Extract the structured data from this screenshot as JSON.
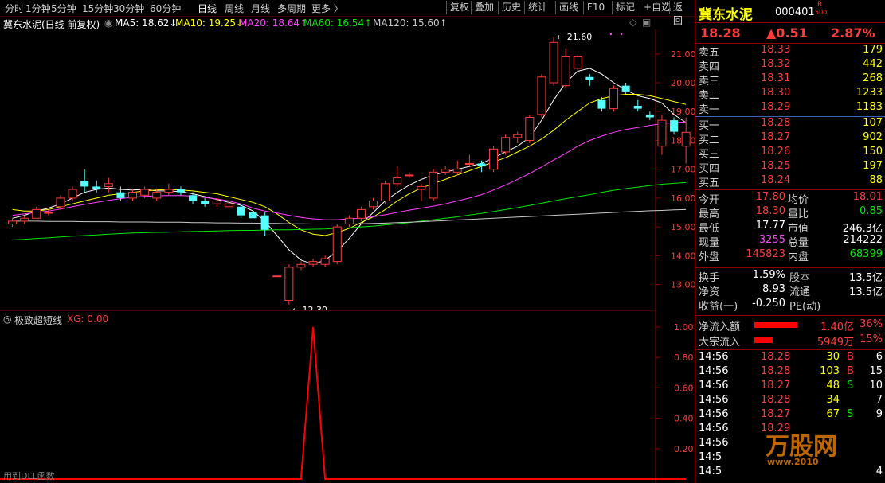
{
  "toolbar": {
    "periods": [
      "分时",
      "1分钟",
      "5分钟",
      "15分钟",
      "30分钟",
      "60分钟",
      "日线",
      "周线",
      "月线",
      "多周期",
      "更多 〉"
    ],
    "active": "日线",
    "buttons": [
      "复权",
      "叠加",
      "历史",
      "统计",
      "画线",
      "F10",
      "标记",
      "+自选",
      "返回"
    ]
  },
  "chart_header": {
    "title": "冀东水泥(日线 前复权)",
    "ma": [
      {
        "label": "MA5: 18.62↓",
        "color": "#ffffff"
      },
      {
        "label": "MA10: 19.25↓",
        "color": "#ffff00"
      },
      {
        "label": "MA20: 18.64↑",
        "color": "#ff40ff"
      },
      {
        "label": "MA60: 16.54↑",
        "color": "#00e600"
      },
      {
        "label": "MA120: 15.60↑",
        "color": "#c8c8c8"
      }
    ]
  },
  "chart_data": {
    "type": "candlestick",
    "y_ticks": [
      21.0,
      20.0,
      19.0,
      18.0,
      17.0,
      16.0,
      15.0,
      14.0,
      13.0
    ],
    "ylim": [
      12.05,
      21.85
    ],
    "high_label": "21.60",
    "low_label": "12.30",
    "low_marker": "跌",
    "candles": [
      [
        15.1,
        15.3,
        15.0,
        15.2
      ],
      [
        15.2,
        15.4,
        15.1,
        15.3
      ],
      [
        15.3,
        15.7,
        15.3,
        15.6
      ],
      [
        15.5,
        15.6,
        15.4,
        15.5
      ],
      [
        15.7,
        16.1,
        15.6,
        16.0
      ],
      [
        16.0,
        16.4,
        15.9,
        16.3
      ],
      [
        16.6,
        17.0,
        16.2,
        16.4
      ],
      [
        16.4,
        16.6,
        16.2,
        16.3
      ],
      [
        16.4,
        16.7,
        16.2,
        16.5
      ],
      [
        16.2,
        16.4,
        15.9,
        16.0
      ],
      [
        16.0,
        16.3,
        15.9,
        16.2
      ],
      [
        16.1,
        16.4,
        16.0,
        16.3
      ],
      [
        16.0,
        16.3,
        15.9,
        16.2
      ],
      [
        16.2,
        16.5,
        16.1,
        16.3
      ],
      [
        16.3,
        16.4,
        16.1,
        16.2
      ],
      [
        16.1,
        16.2,
        15.8,
        15.9
      ],
      [
        15.9,
        16.0,
        15.7,
        15.8
      ],
      [
        15.8,
        16.0,
        15.7,
        15.9
      ],
      [
        15.7,
        15.9,
        15.6,
        15.8
      ],
      [
        15.7,
        15.8,
        15.3,
        15.4
      ],
      [
        15.5,
        15.6,
        15.2,
        15.3
      ],
      [
        15.4,
        15.5,
        14.7,
        14.9
      ],
      [
        13.3,
        13.3,
        13.3,
        13.3
      ],
      [
        12.45,
        13.7,
        12.3,
        13.6
      ],
      [
        13.6,
        13.8,
        13.5,
        13.7
      ],
      [
        13.7,
        13.9,
        13.6,
        13.8
      ],
      [
        13.7,
        14.0,
        13.6,
        13.9
      ],
      [
        13.8,
        15.1,
        13.7,
        15.0
      ],
      [
        15.1,
        15.4,
        15.0,
        15.3
      ],
      [
        15.3,
        15.7,
        15.2,
        15.6
      ],
      [
        15.7,
        16.0,
        15.6,
        15.9
      ],
      [
        15.9,
        16.6,
        15.8,
        16.5
      ],
      [
        16.5,
        17.1,
        16.4,
        16.7
      ],
      [
        16.8,
        16.9,
        16.7,
        16.8
      ],
      [
        16.3,
        16.5,
        15.9,
        16.4
      ],
      [
        16.0,
        17.0,
        15.9,
        16.9
      ],
      [
        16.9,
        17.1,
        16.8,
        17.0
      ],
      [
        16.9,
        17.3,
        16.8,
        17.0
      ],
      [
        17.2,
        17.5,
        17.1,
        17.2
      ],
      [
        17.2,
        17.3,
        16.9,
        17.1
      ],
      [
        17.0,
        17.8,
        16.9,
        17.7
      ],
      [
        17.6,
        18.2,
        17.5,
        18.1
      ],
      [
        18.1,
        18.3,
        17.9,
        18.2
      ],
      [
        18.0,
        18.9,
        17.9,
        18.8
      ],
      [
        18.9,
        20.3,
        18.8,
        20.2
      ],
      [
        20.0,
        21.6,
        19.9,
        21.4
      ],
      [
        19.9,
        21.2,
        19.8,
        20.9
      ],
      [
        20.5,
        21.0,
        20.4,
        20.9
      ],
      [
        20.2,
        20.3,
        19.9,
        20.1
      ],
      [
        19.4,
        19.5,
        19.0,
        19.1
      ],
      [
        19.1,
        19.9,
        19.0,
        19.8
      ],
      [
        19.9,
        20.0,
        19.6,
        19.7
      ],
      [
        19.2,
        19.4,
        19.0,
        19.1
      ],
      [
        18.9,
        19.0,
        18.7,
        18.8
      ],
      [
        17.8,
        18.9,
        17.5,
        18.7
      ],
      [
        18.7,
        18.8,
        18.2,
        18.3
      ],
      [
        17.8,
        18.8,
        17.2,
        18.28
      ]
    ],
    "ma_series": [
      {
        "name": "MA5",
        "color": "#ffffff",
        "values": [
          15.3,
          15.4,
          15.55,
          15.65,
          15.8,
          16.0,
          16.2,
          16.3,
          16.35,
          16.3,
          16.28,
          16.3,
          16.25,
          16.25,
          16.22,
          16.15,
          16.05,
          15.95,
          15.85,
          15.75,
          15.55,
          15.2,
          14.7,
          14.2,
          13.85,
          13.7,
          13.85,
          14.15,
          14.6,
          15.1,
          15.5,
          15.9,
          16.2,
          16.45,
          16.65,
          16.8,
          16.9,
          17.0,
          17.1,
          17.2,
          17.4,
          17.6,
          17.8,
          18.1,
          18.7,
          19.4,
          20.0,
          20.4,
          20.5,
          20.3,
          20.0,
          19.75,
          19.55,
          19.45,
          19.3,
          18.9,
          18.62
        ]
      },
      {
        "name": "MA10",
        "color": "#ffff00",
        "values": [
          15.6,
          15.55,
          15.55,
          15.6,
          15.7,
          15.8,
          15.9,
          16.0,
          16.1,
          16.15,
          16.2,
          16.25,
          16.28,
          16.3,
          16.28,
          16.25,
          16.2,
          16.15,
          16.05,
          15.95,
          15.85,
          15.7,
          15.45,
          15.15,
          14.9,
          14.75,
          14.7,
          14.8,
          14.95,
          15.15,
          15.35,
          15.6,
          15.9,
          16.15,
          16.35,
          16.5,
          16.65,
          16.8,
          16.95,
          17.1,
          17.25,
          17.4,
          17.6,
          17.8,
          18.05,
          18.35,
          18.7,
          19.0,
          19.3,
          19.45,
          19.55,
          19.6,
          19.6,
          19.55,
          19.45,
          19.35,
          19.25
        ]
      },
      {
        "name": "MA20",
        "color": "#ff40ff",
        "values": [
          15.4,
          15.45,
          15.5,
          15.55,
          15.62,
          15.7,
          15.78,
          15.85,
          15.92,
          15.98,
          16.03,
          16.06,
          16.08,
          16.09,
          16.09,
          16.07,
          16.02,
          15.97,
          15.9,
          15.8,
          15.65,
          15.55,
          15.48,
          15.4,
          15.33,
          15.28,
          15.25,
          15.25,
          15.28,
          15.3,
          15.35,
          15.42,
          15.5,
          15.58,
          15.65,
          15.72,
          15.8,
          15.9,
          16.0,
          16.12,
          16.28,
          16.45,
          16.65,
          16.85,
          17.08,
          17.32,
          17.55,
          17.8,
          18.0,
          18.15,
          18.28,
          18.38,
          18.45,
          18.52,
          18.58,
          18.62,
          18.64
        ]
      },
      {
        "name": "MA60",
        "color": "#00e600",
        "values": [
          14.55,
          14.57,
          14.6,
          14.62,
          14.65,
          14.68,
          14.7,
          14.72,
          14.75,
          14.77,
          14.79,
          14.8,
          14.81,
          14.82,
          14.83,
          14.84,
          14.85,
          14.86,
          14.87,
          14.88,
          14.88,
          14.89,
          14.9,
          14.9,
          14.91,
          14.92,
          14.93,
          14.95,
          14.97,
          15.0,
          15.03,
          15.07,
          15.11,
          15.15,
          15.2,
          15.25,
          15.3,
          15.35,
          15.41,
          15.47,
          15.53,
          15.6,
          15.67,
          15.74,
          15.82,
          15.9,
          15.98,
          16.05,
          16.12,
          16.2,
          16.27,
          16.33,
          16.38,
          16.43,
          16.48,
          16.51,
          16.54
        ]
      },
      {
        "name": "MA120",
        "color": "#c8c8c8",
        "values": [
          15.2,
          15.2,
          15.2,
          15.19,
          15.19,
          15.19,
          15.18,
          15.18,
          15.18,
          15.17,
          15.17,
          15.17,
          15.16,
          15.16,
          15.16,
          15.15,
          15.15,
          15.14,
          15.14,
          15.13,
          15.13,
          15.12,
          15.12,
          15.11,
          15.11,
          15.1,
          15.1,
          15.1,
          15.1,
          15.11,
          15.12,
          15.13,
          15.15,
          15.16,
          15.18,
          15.2,
          15.22,
          15.24,
          15.26,
          15.28,
          15.3,
          15.32,
          15.34,
          15.36,
          15.38,
          15.4,
          15.42,
          15.44,
          15.46,
          15.48,
          15.5,
          15.52,
          15.54,
          15.56,
          15.57,
          15.59,
          15.6
        ]
      }
    ],
    "indicator": {
      "name": "极致超短线",
      "value_label": "XG: 0.00",
      "y_ticks": [
        1.0,
        0.8,
        0.6,
        0.4,
        0.2
      ],
      "values_nonzero_index": 25,
      "values": [
        0,
        0,
        0,
        0,
        0,
        0,
        0,
        0,
        0,
        0,
        0,
        0,
        0,
        0,
        0,
        0,
        0,
        0,
        0,
        0,
        0,
        0,
        0,
        0,
        0,
        1,
        0,
        0,
        0,
        0,
        0,
        0,
        0,
        0,
        0,
        0,
        0,
        0,
        0,
        0,
        0,
        0,
        0,
        0,
        0,
        0,
        0,
        0,
        0,
        0,
        0,
        0,
        0,
        0,
        0,
        0,
        0
      ]
    },
    "footer_note": "用到DLL函数"
  },
  "stock": {
    "name": "冀东水泥",
    "code": "000401",
    "badge_r": "R",
    "badge_num": "500",
    "price": "18.28",
    "change": "▲0.51",
    "pct": "2.87%"
  },
  "orderbook": {
    "asks": [
      {
        "label": "卖五",
        "price": "18.33",
        "vol": "179"
      },
      {
        "label": "卖四",
        "price": "18.32",
        "vol": "442"
      },
      {
        "label": "卖三",
        "price": "18.31",
        "vol": "268"
      },
      {
        "label": "卖二",
        "price": "18.30",
        "vol": "1233"
      },
      {
        "label": "卖一",
        "price": "18.29",
        "vol": "1183"
      }
    ],
    "bids": [
      {
        "label": "买一",
        "price": "18.28",
        "vol": "107"
      },
      {
        "label": "买二",
        "price": "18.27",
        "vol": "902"
      },
      {
        "label": "买三",
        "price": "18.26",
        "vol": "150"
      },
      {
        "label": "买四",
        "price": "18.25",
        "vol": "197"
      },
      {
        "label": "买五",
        "price": "18.24",
        "vol": "88"
      }
    ]
  },
  "stats": [
    {
      "l1": "今开",
      "v1": "17.80",
      "c1": "red",
      "l2": "均价",
      "v2": "18.01",
      "c2": "red"
    },
    {
      "l1": "最高",
      "v1": "18.30",
      "c1": "red",
      "l2": "量比",
      "v2": "0.85",
      "c2": "green"
    },
    {
      "l1": "最低",
      "v1": "17.77",
      "c1": "white",
      "l2": "市值",
      "v2": "246.3亿",
      "c2": "white"
    },
    {
      "l1": "现量",
      "v1": "3255",
      "c1": "mag",
      "l2": "总量",
      "v2": "214222",
      "c2": "white"
    },
    {
      "l1": "外盘",
      "v1": "145823",
      "c1": "red",
      "l2": "内盘",
      "v2": "68399",
      "c2": "green"
    }
  ],
  "stats2": [
    {
      "l1": "换手",
      "v1": "1.59%",
      "l2": "股本",
      "v2": "13.5亿"
    },
    {
      "l1": "净资",
      "v1": "8.93",
      "l2": "流通",
      "v2": "13.5亿"
    },
    {
      "l1": "收益(一)",
      "v1": "-0.250",
      "l2": "PE(动)",
      "v2": ""
    }
  ],
  "flow": [
    {
      "label": "净流入额",
      "amount": "1.40亿",
      "pct": "36%",
      "bar": 0.36
    },
    {
      "label": "大宗流入",
      "amount": "5949万",
      "pct": "15%",
      "bar": 0.15
    }
  ],
  "ticks": [
    {
      "time": "14:56",
      "price": "18.28",
      "vol": "30",
      "side": "B",
      "n": "6"
    },
    {
      "time": "14:56",
      "price": "18.28",
      "vol": "103",
      "side": "B",
      "n": "15"
    },
    {
      "time": "14:56",
      "price": "18.27",
      "vol": "48",
      "side": "S",
      "n": "10"
    },
    {
      "time": "14:56",
      "price": "18.28",
      "vol": "34",
      "side": "",
      "n": "7"
    },
    {
      "time": "14:56",
      "price": "18.27",
      "vol": "67",
      "side": "S",
      "n": "9"
    },
    {
      "time": "14:56",
      "price": "18.29",
      "vol": "",
      "side": "",
      "n": ""
    },
    {
      "time": "14:56",
      "price": "",
      "vol": "",
      "side": "",
      "n": ""
    },
    {
      "time": "14:5",
      "price": "",
      "vol": "",
      "side": "",
      "n": ""
    },
    {
      "time": "14:5",
      "price": "",
      "vol": "",
      "side": "",
      "n": "4"
    }
  ],
  "watermark": {
    "text": "万股网",
    "url": "www.2010"
  }
}
